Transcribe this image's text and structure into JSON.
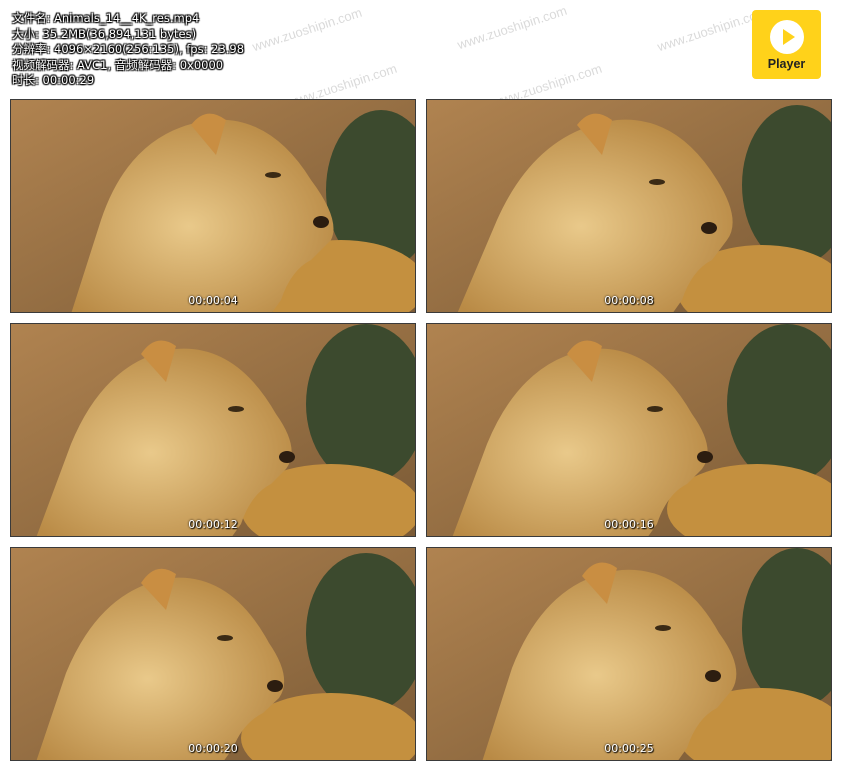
{
  "file_info": {
    "filename": "文件名: Animals_14__4K_res.mp4",
    "size": "大小: 35.2MB(36,894,131 bytes)",
    "resolution": "分辨率: 4096×2160(256:135), fps: 23.98",
    "codec": "视频解码器: AVC1, 音频解码器: 0x0000",
    "duration": "时长: 00:00:29"
  },
  "logo": {
    "label": "Player",
    "icon": "play-icon",
    "color": "#ffd21a"
  },
  "watermark": "www.zuoshipin.com",
  "thumbnails": [
    {
      "timestamp": "00:00:04"
    },
    {
      "timestamp": "00:00:08"
    },
    {
      "timestamp": "00:00:12"
    },
    {
      "timestamp": "00:00:16"
    },
    {
      "timestamp": "00:00:20"
    },
    {
      "timestamp": "00:00:25"
    }
  ]
}
